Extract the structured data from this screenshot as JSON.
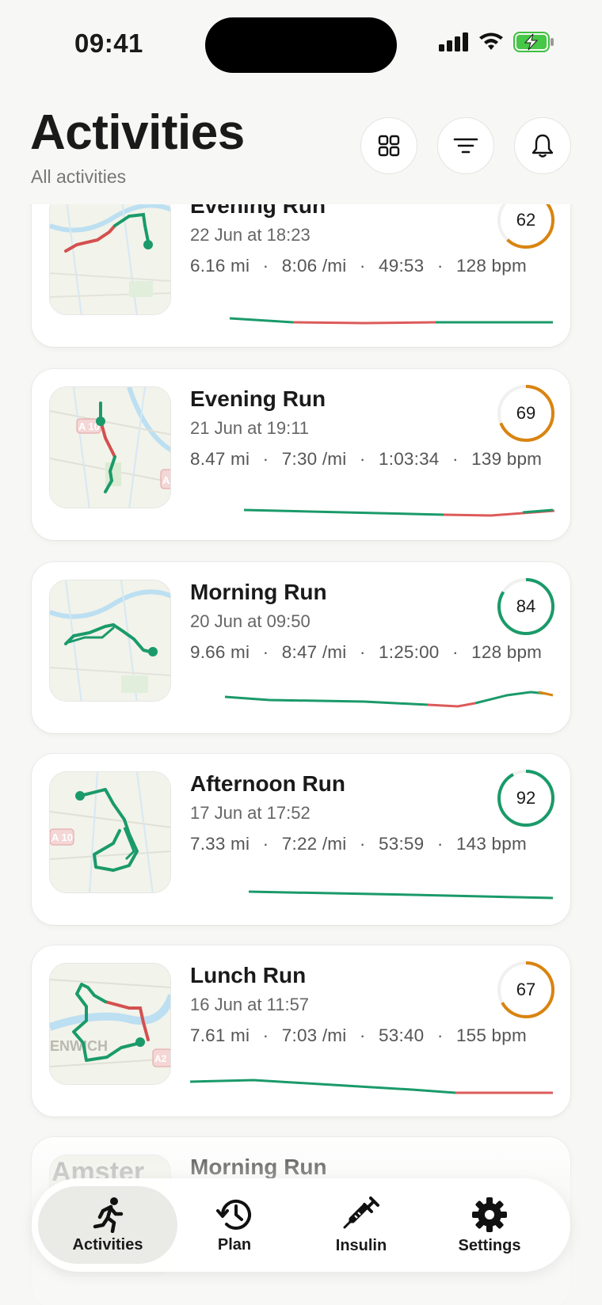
{
  "status_bar": {
    "time": "09:41"
  },
  "header": {
    "title": "Activities",
    "subtitle": "All activities"
  },
  "activities": [
    {
      "title": "Evening Run",
      "date": "22 Jun at 18:23",
      "distance": "6.16 mi",
      "pace": "8:06 /mi",
      "duration": "49:53",
      "heart_rate": "128 bpm",
      "score": "62",
      "score_fraction": 0.62,
      "score_color": "#d98410"
    },
    {
      "title": "Evening Run",
      "date": "21 Jun at 19:11",
      "distance": "8.47 mi",
      "pace": "7:30 /mi",
      "duration": "1:03:34",
      "heart_rate": "139 bpm",
      "score": "69",
      "score_fraction": 0.69,
      "score_color": "#d98410"
    },
    {
      "title": "Morning Run",
      "date": "20 Jun at 09:50",
      "distance": "9.66 mi",
      "pace": "8:47 /mi",
      "duration": "1:25:00",
      "heart_rate": "128 bpm",
      "score": "84",
      "score_fraction": 0.84,
      "score_color": "#1a9a6a"
    },
    {
      "title": "Afternoon Run",
      "date": "17 Jun at 17:52",
      "distance": "7.33 mi",
      "pace": "7:22 /mi",
      "duration": "53:59",
      "heart_rate": "143 bpm",
      "score": "92",
      "score_fraction": 0.92,
      "score_color": "#1a9a6a"
    },
    {
      "title": "Lunch Run",
      "date": "16 Jun at 11:57",
      "distance": "7.61 mi",
      "pace": "7:03 /mi",
      "duration": "53:40",
      "heart_rate": "155 bpm",
      "score": "67",
      "score_fraction": 0.67,
      "score_color": "#d98410"
    },
    {
      "title": "Morning Run",
      "date": "",
      "distance": "",
      "pace": "",
      "duration": "",
      "heart_rate": "",
      "score": "",
      "score_fraction": 0,
      "score_color": "#1a9a6a"
    }
  ],
  "map_labels": {
    "road_a10": "A 10",
    "road_a2": "A2",
    "greenwich": "ENWICH",
    "amsterdam": "Amster"
  },
  "stat_separator": "·",
  "tabs": [
    {
      "label": "Activities",
      "icon": "running-person-icon",
      "active": true
    },
    {
      "label": "Plan",
      "icon": "history-clock-icon",
      "active": false
    },
    {
      "label": "Insulin",
      "icon": "syringe-icon",
      "active": false
    },
    {
      "label": "Settings",
      "icon": "gear-icon",
      "active": false
    }
  ],
  "colors": {
    "good": "#1a9a6a",
    "warn": "#d98410",
    "bad": "#dd5a5a"
  }
}
